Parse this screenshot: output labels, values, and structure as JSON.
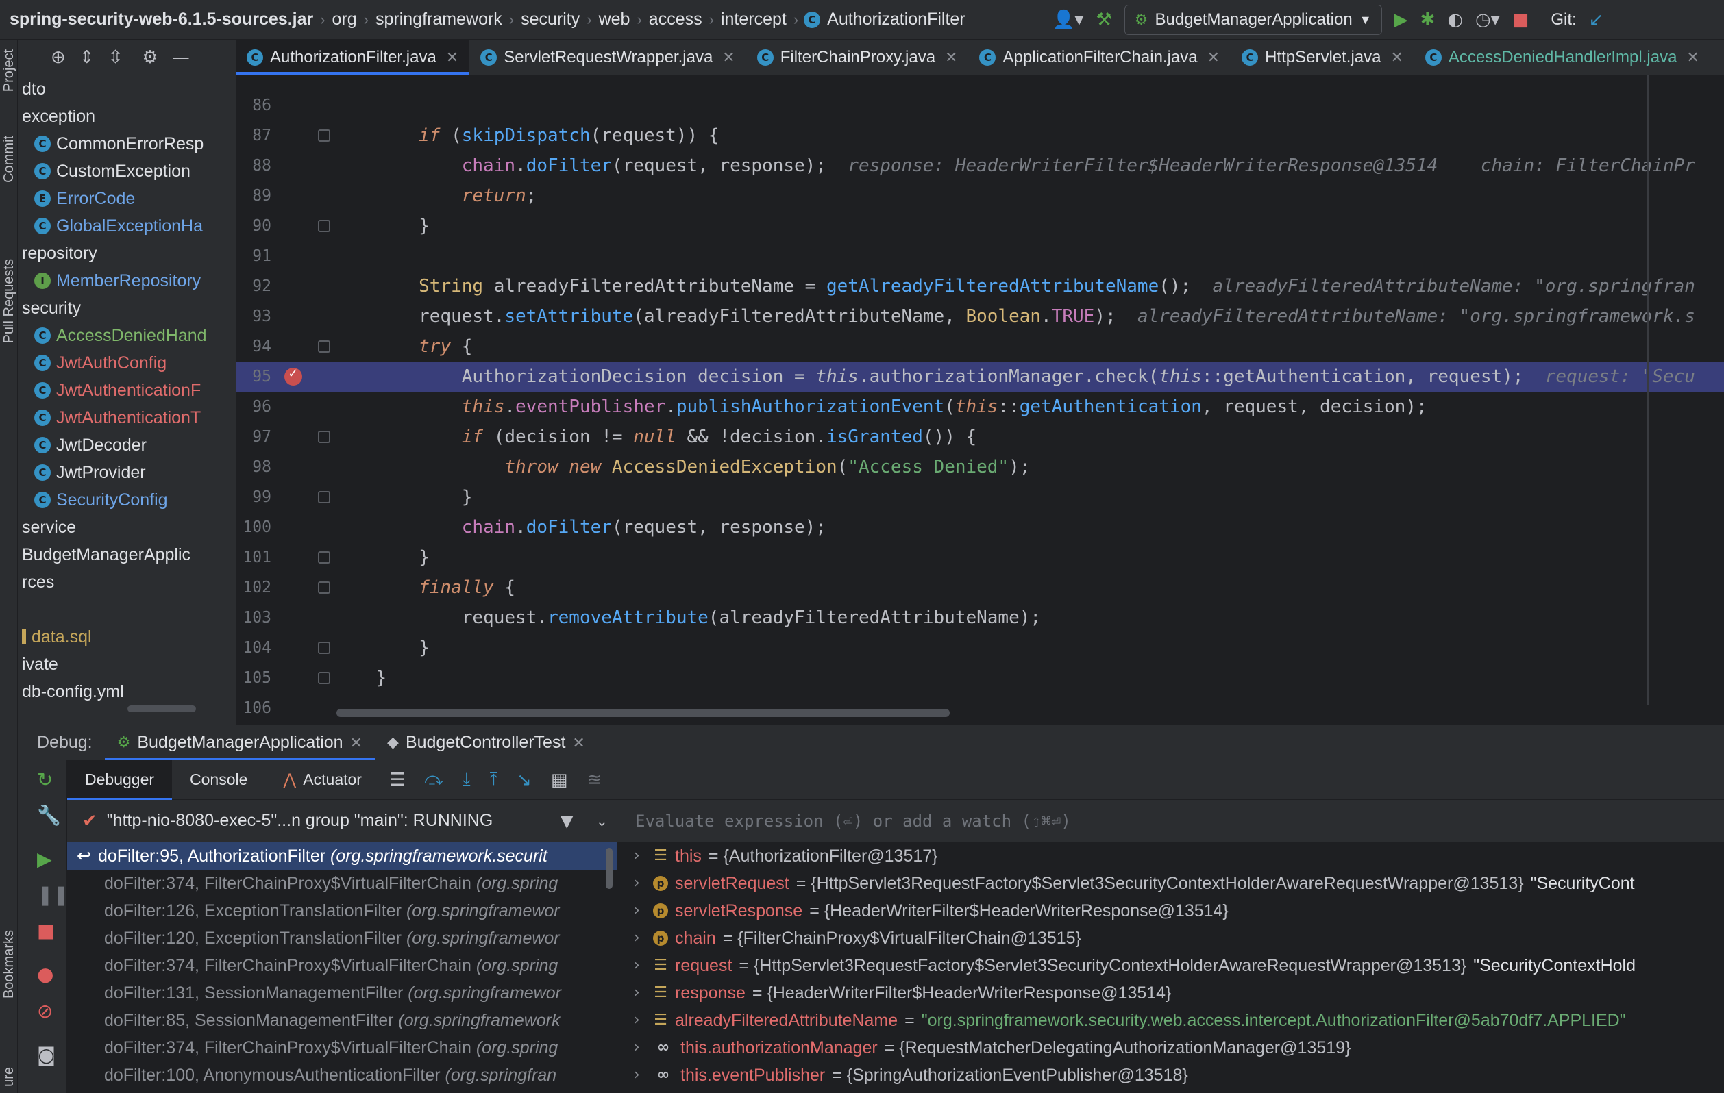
{
  "breadcrumb": {
    "items": [
      "spring-security-web-6.1.5-sources.jar",
      "org",
      "springframework",
      "security",
      "web",
      "access",
      "intercept",
      "AuthorizationFilter"
    ]
  },
  "toolbar": {
    "run_config": "BudgetManagerApplication",
    "git_label": "Git:"
  },
  "left_strip": {
    "project": "Project",
    "commit": "Commit",
    "pull_requests": "Pull Requests",
    "bookmarks": "Bookmarks",
    "structure": "ure"
  },
  "project_tree": [
    {
      "label": "dto",
      "kind": "pkg"
    },
    {
      "label": "exception",
      "kind": "pkg"
    },
    {
      "label": "CommonErrorResp",
      "kind": "class",
      "color": "default"
    },
    {
      "label": "CustomException",
      "kind": "class",
      "color": "default"
    },
    {
      "label": "ErrorCode",
      "kind": "enum",
      "color": "blue"
    },
    {
      "label": "GlobalExceptionHa",
      "kind": "class",
      "color": "blue"
    },
    {
      "label": "repository",
      "kind": "pkg"
    },
    {
      "label": "MemberRepository",
      "kind": "interface",
      "color": "blue"
    },
    {
      "label": "security",
      "kind": "pkg"
    },
    {
      "label": "AccessDeniedHand",
      "kind": "class",
      "color": "green"
    },
    {
      "label": "JwtAuthConfig",
      "kind": "class",
      "color": "red"
    },
    {
      "label": "JwtAuthenticationF",
      "kind": "class",
      "color": "red"
    },
    {
      "label": "JwtAuthenticationT",
      "kind": "class",
      "color": "red"
    },
    {
      "label": "JwtDecoder",
      "kind": "class",
      "color": "default"
    },
    {
      "label": "JwtProvider",
      "kind": "class",
      "color": "default"
    },
    {
      "label": "SecurityConfig",
      "kind": "class",
      "color": "blue"
    },
    {
      "label": "service",
      "kind": "pkg"
    },
    {
      "label": "BudgetManagerApplic",
      "kind": "cut"
    },
    {
      "label": "rces",
      "kind": "cut"
    },
    {
      "label": "",
      "kind": "cut"
    },
    {
      "label": "data.sql",
      "kind": "file",
      "color": "yellow"
    },
    {
      "label": "ivate",
      "kind": "cut"
    },
    {
      "label": "db-config.yml",
      "kind": "cut"
    }
  ],
  "tabs": [
    {
      "label": "AuthorizationFilter.java",
      "active": true
    },
    {
      "label": "ServletRequestWrapper.java",
      "active": false
    },
    {
      "label": "FilterChainProxy.java",
      "active": false
    },
    {
      "label": "ApplicationFilterChain.java",
      "active": false
    },
    {
      "label": "HttpServlet.java",
      "active": false
    },
    {
      "label": "AccessDeniedHandlerImpl.java",
      "active": false
    }
  ],
  "editor": {
    "current_line": 95,
    "lines": [
      {
        "n": "86",
        "code": ""
      },
      {
        "n": "87",
        "code": "        <span class='kw'>if</span> (<span class='mth'>skipDispatch</span>(request)) {"
      },
      {
        "n": "88",
        "code": "            <span class='fld'>chain</span>.<span class='mth'>doFilter</span>(request, response);  <span class='hint'>response: HeaderWriterFilter$HeaderWriterResponse@13514    chain: FilterChainPr</span>"
      },
      {
        "n": "89",
        "code": "            <span class='kw'>return</span>;"
      },
      {
        "n": "90",
        "code": "        }"
      },
      {
        "n": "91",
        "code": ""
      },
      {
        "n": "92",
        "code": "        <span class='typ'>String</span> alreadyFilteredAttributeName = <span class='mth'>getAlreadyFilteredAttributeName</span>();  <span class='hint'>alreadyFilteredAttributeName: \"org.springfran</span>"
      },
      {
        "n": "93",
        "code": "        request.<span class='mth'>setAttribute</span>(alreadyFilteredAttributeName, <span class='typ'>Boolean</span>.<span class='fld'>TRUE</span>);  <span class='hint'>alreadyFilteredAttributeName: \"org.springframework.s</span>"
      },
      {
        "n": "94",
        "code": "        <span class='kw'>try</span> {"
      },
      {
        "n": "95",
        "code": "            AuthorizationDecision decision = <span style='font-style:italic'>this</span>.authorizationManager.check(<span style='font-style:italic'>this</span>::getAuthentication, request);  <span class='hint'>request: \"Secu</span>"
      },
      {
        "n": "96",
        "code": "            <span class='kw'>this</span>.<span class='fld'>eventPublisher</span>.<span class='mth'>publishAuthorizationEvent</span>(<span class='kw'>this</span>::<span class='mth'>getAuthentication</span>, request, decision);"
      },
      {
        "n": "97",
        "code": "            <span class='kw'>if</span> (decision != <span class='kw'>null</span> &amp;&amp; !decision.<span class='mth'>isGranted</span>()) {"
      },
      {
        "n": "98",
        "code": "                <span class='kw'>throw</span> <span class='kw'>new</span> <span class='typ'>AccessDeniedException</span>(<span class='str'>\"Access Denied\"</span>);"
      },
      {
        "n": "99",
        "code": "            }"
      },
      {
        "n": "100",
        "code": "            <span class='fld'>chain</span>.<span class='mth'>doFilter</span>(request, response);"
      },
      {
        "n": "101",
        "code": "        }"
      },
      {
        "n": "102",
        "code": "        <span class='kw'>finally</span> {"
      },
      {
        "n": "103",
        "code": "            request.<span class='mth'>removeAttribute</span>(alreadyFilteredAttributeName);"
      },
      {
        "n": "104",
        "code": "        }"
      },
      {
        "n": "105",
        "code": "    }"
      },
      {
        "n": "106",
        "code": ""
      }
    ]
  },
  "debug": {
    "label": "Debug:",
    "sessions": [
      {
        "label": "BudgetManagerApplication",
        "active": true
      },
      {
        "label": "BudgetControllerTest",
        "active": false
      }
    ],
    "subtabs": [
      "Debugger",
      "Console",
      "Actuator"
    ],
    "thread": "\"http-nio-8080-exec-5\"...n group \"main\": RUNNING",
    "frames": [
      {
        "method": "doFilter:95, AuthorizationFilter",
        "pkg": "(org.springframework.securit",
        "selected": true
      },
      {
        "method": "doFilter:374, FilterChainProxy$VirtualFilterChain",
        "pkg": "(org.spring"
      },
      {
        "method": "doFilter:126, ExceptionTranslationFilter",
        "pkg": "(org.springframewor"
      },
      {
        "method": "doFilter:120, ExceptionTranslationFilter",
        "pkg": "(org.springframewor"
      },
      {
        "method": "doFilter:374, FilterChainProxy$VirtualFilterChain",
        "pkg": "(org.spring"
      },
      {
        "method": "doFilter:131, SessionManagementFilter",
        "pkg": "(org.springframewor"
      },
      {
        "method": "doFilter:85, SessionManagementFilter",
        "pkg": "(org.springframework"
      },
      {
        "method": "doFilter:374, FilterChainProxy$VirtualFilterChain",
        "pkg": "(org.spring"
      },
      {
        "method": "doFilter:100, AnonymousAuthenticationFilter",
        "pkg": "(org.springfran"
      }
    ],
    "eval_placeholder": "Evaluate expression (⏎) or add a watch (⇧⌘⏎)",
    "variables": [
      {
        "icon": "field",
        "name": "this",
        "value": "= {AuthorizationFilter@13517}",
        "extra": ""
      },
      {
        "icon": "param",
        "name": "servletRequest",
        "value": "= {HttpServlet3RequestFactory$Servlet3SecurityContextHolderAwareRequestWrapper@13513}",
        "extra": "\"SecurityCont"
      },
      {
        "icon": "param",
        "name": "servletResponse",
        "value": "= {HeaderWriterFilter$HeaderWriterResponse@13514}",
        "extra": ""
      },
      {
        "icon": "param",
        "name": "chain",
        "value": "= {FilterChainProxy$VirtualFilterChain@13515}",
        "extra": ""
      },
      {
        "icon": "field",
        "name": "request",
        "value": "= {HttpServlet3RequestFactory$Servlet3SecurityContextHolderAwareRequestWrapper@13513}",
        "extra": "\"SecurityContextHold"
      },
      {
        "icon": "field",
        "name": "response",
        "value": "= {HeaderWriterFilter$HeaderWriterResponse@13514}",
        "extra": ""
      },
      {
        "icon": "field",
        "name": "alreadyFilteredAttributeName",
        "value": "= ",
        "str": "\"org.springframework.security.web.access.intercept.AuthorizationFilter@5ab70df7.APPLIED\""
      },
      {
        "icon": "watch",
        "name": "this.authorizationManager",
        "value": "= {RequestMatcherDelegatingAuthorizationManager@13519}",
        "extra": ""
      },
      {
        "icon": "watch",
        "name": "this.eventPublisher",
        "value": "= {SpringAuthorizationEventPublisher@13518}",
        "extra": ""
      }
    ]
  }
}
